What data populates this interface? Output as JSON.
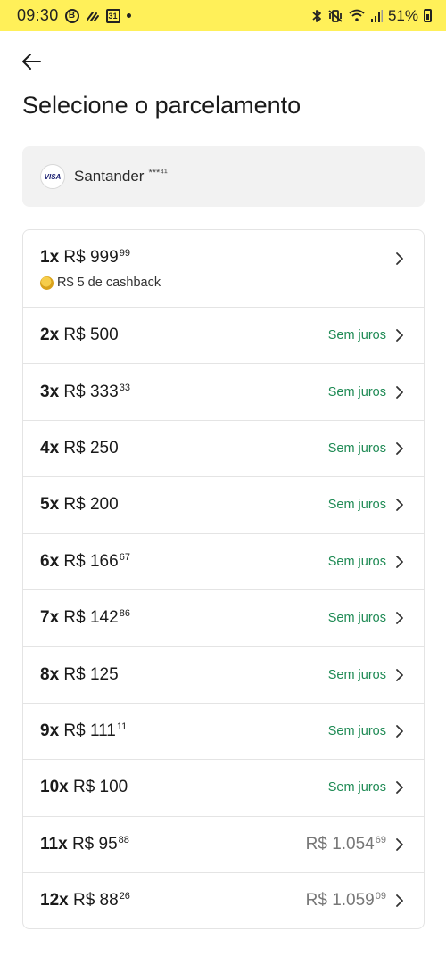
{
  "status_bar": {
    "time": "09:30",
    "badge_b": "B",
    "calendar": "31",
    "battery": "51%"
  },
  "page": {
    "title": "Selecione o parcelamento"
  },
  "card": {
    "brand": "VISA",
    "name": "Santander",
    "mask": "***⁴¹"
  },
  "cashback_text": "R$ 5 de cashback",
  "installments": [
    {
      "count": "1x",
      "amount": "R$ 999",
      "cents": "99",
      "tag": "",
      "total": "",
      "total_cents": ""
    },
    {
      "count": "2x",
      "amount": "R$ 500",
      "cents": "",
      "tag": "Sem juros",
      "total": "",
      "total_cents": ""
    },
    {
      "count": "3x",
      "amount": "R$ 333",
      "cents": "33",
      "tag": "Sem juros",
      "total": "",
      "total_cents": ""
    },
    {
      "count": "4x",
      "amount": "R$ 250",
      "cents": "",
      "tag": "Sem juros",
      "total": "",
      "total_cents": ""
    },
    {
      "count": "5x",
      "amount": "R$ 200",
      "cents": "",
      "tag": "Sem juros",
      "total": "",
      "total_cents": ""
    },
    {
      "count": "6x",
      "amount": "R$ 166",
      "cents": "67",
      "tag": "Sem juros",
      "total": "",
      "total_cents": ""
    },
    {
      "count": "7x",
      "amount": "R$ 142",
      "cents": "86",
      "tag": "Sem juros",
      "total": "",
      "total_cents": ""
    },
    {
      "count": "8x",
      "amount": "R$ 125",
      "cents": "",
      "tag": "Sem juros",
      "total": "",
      "total_cents": ""
    },
    {
      "count": "9x",
      "amount": "R$ 111",
      "cents": "11",
      "tag": "Sem juros",
      "total": "",
      "total_cents": ""
    },
    {
      "count": "10x",
      "amount": "R$ 100",
      "cents": "",
      "tag": "Sem juros",
      "total": "",
      "total_cents": ""
    },
    {
      "count": "11x",
      "amount": "R$ 95",
      "cents": "88",
      "tag": "",
      "total": "R$ 1.054",
      "total_cents": "69"
    },
    {
      "count": "12x",
      "amount": "R$ 88",
      "cents": "26",
      "tag": "",
      "total": "R$ 1.059",
      "total_cents": "09"
    }
  ],
  "colors": {
    "status_bar_bg": "#fff059",
    "interest_free_green": "#1e8a54",
    "total_gray": "#777777"
  }
}
